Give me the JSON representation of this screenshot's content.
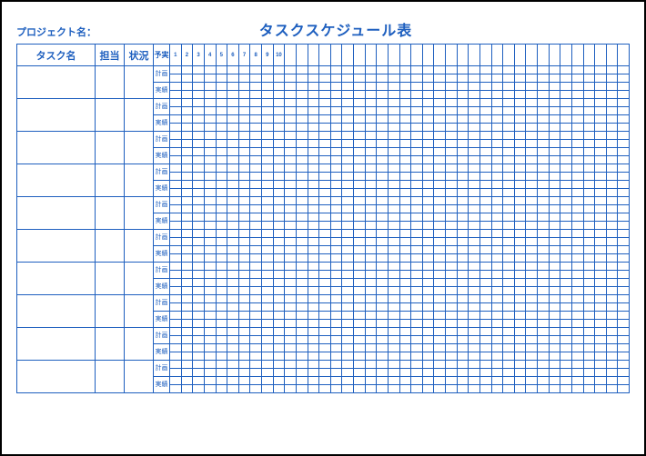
{
  "header": {
    "project_label": "プロジェクト名：",
    "title": "タスクスケジュール表"
  },
  "columns": {
    "task": "タスク名",
    "person": "担当",
    "status": "状況",
    "type_header": "予実"
  },
  "row_types": {
    "plan": "計画",
    "actual": "実績"
  },
  "day_numbers": [
    "1",
    "2",
    "3",
    "4",
    "5",
    "6",
    "7",
    "8",
    "9",
    "10"
  ],
  "day_columns_total": 40,
  "task_rows": 10,
  "chart_data": {
    "type": "table",
    "title": "タスクスケジュール表",
    "columns": [
      "タスク名",
      "担当",
      "状況",
      "予実",
      "1",
      "2",
      "3",
      "4",
      "5",
      "6",
      "7",
      "8",
      "9",
      "10",
      "…×40"
    ],
    "rows_per_task": [
      "計画",
      "実績"
    ],
    "task_count": 10,
    "values": "blank template (no filled cells)"
  }
}
